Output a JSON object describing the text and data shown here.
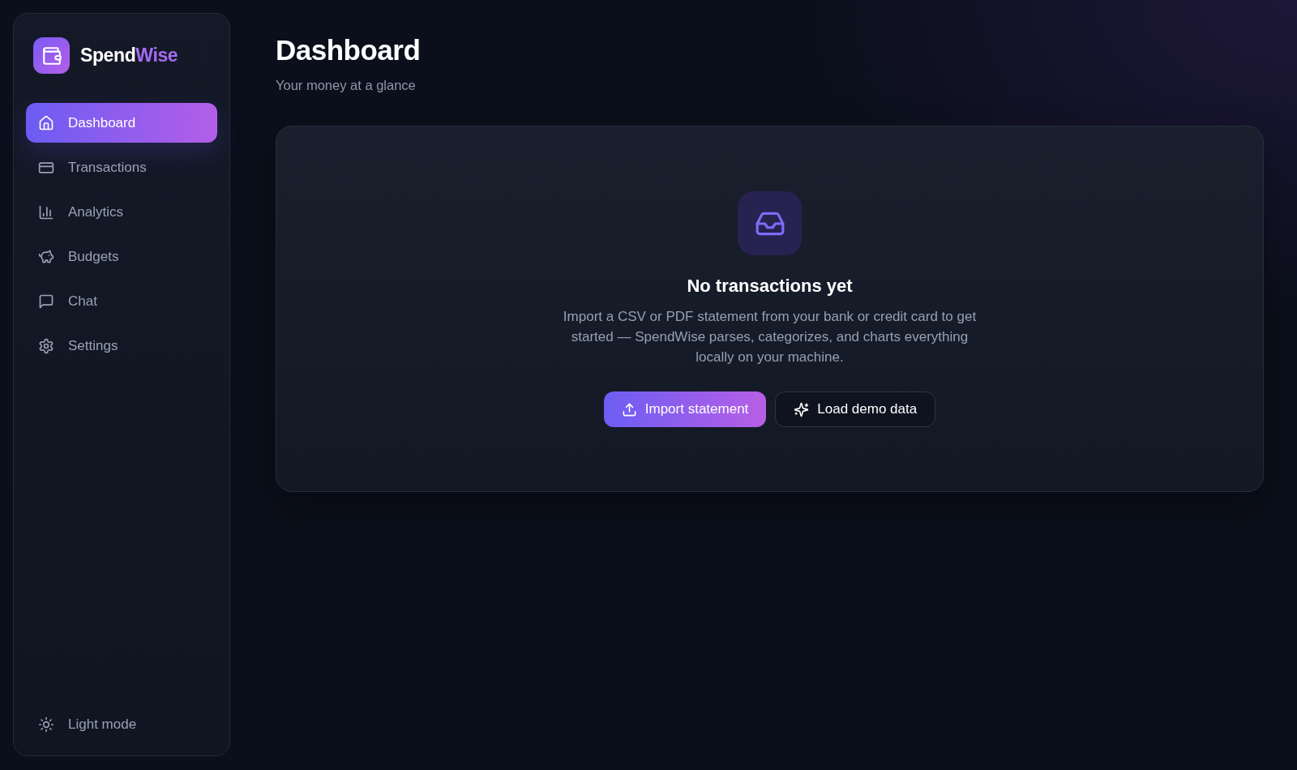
{
  "sidebar": {
    "brand": {
      "name": "Spend",
      "accent": "Wise"
    },
    "nav": [
      {
        "label": "Dashboard",
        "selected": true
      },
      {
        "label": "Transactions",
        "selected": false
      },
      {
        "label": "Analytics",
        "selected": false
      },
      {
        "label": "Budgets",
        "selected": false
      },
      {
        "label": "Chat",
        "selected": false
      },
      {
        "label": "Settings",
        "selected": false
      }
    ],
    "theme_toggle": {
      "label": "Light mode"
    }
  },
  "header": {
    "title": "Dashboard",
    "subtitle": "Your money at a glance"
  },
  "empty_state": {
    "title": "No transactions yet",
    "description": "Import a CSV or PDF statement from your bank or credit card to get started — SpendWise parses, categorizes, and charts everything locally on your machine.",
    "buttons": [
      {
        "label": "Import statement",
        "kind": "primary"
      },
      {
        "label": "Load demo data",
        "kind": "secondary"
      }
    ]
  }
}
